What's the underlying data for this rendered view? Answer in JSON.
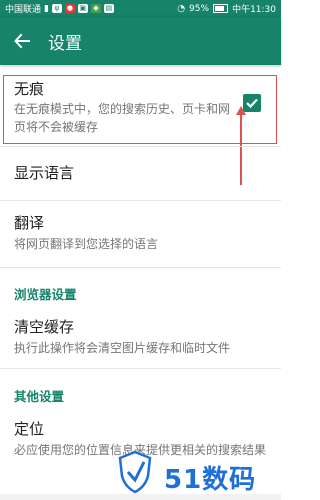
{
  "status_bar": {
    "carrier": "中国联通",
    "battery": "95%",
    "time": "中午11:30"
  },
  "app_bar": {
    "title": "设置"
  },
  "incognito": {
    "title": "无痕",
    "desc": "在无痕模式中，您的搜索历史、页卡和网页将不会被缓存",
    "checked": true
  },
  "language": {
    "title": "显示语言"
  },
  "translate": {
    "title": "翻译",
    "desc": "将网页翻译到您选择的语言"
  },
  "browser_settings": {
    "header": "浏览器设置"
  },
  "clear_cache": {
    "title": "清空缓存",
    "desc": "执行此操作将会清空图片缓存和临时文件"
  },
  "other_settings": {
    "header": "其他设置"
  },
  "location": {
    "title": "定位",
    "desc": "必应使用您的位置信息来提供更相关的搜索结果"
  },
  "watermark": {
    "text": "51数码"
  },
  "colors": {
    "primary": "#16836a",
    "annotation": "#e05050",
    "watermark": "#1f6fd8"
  }
}
